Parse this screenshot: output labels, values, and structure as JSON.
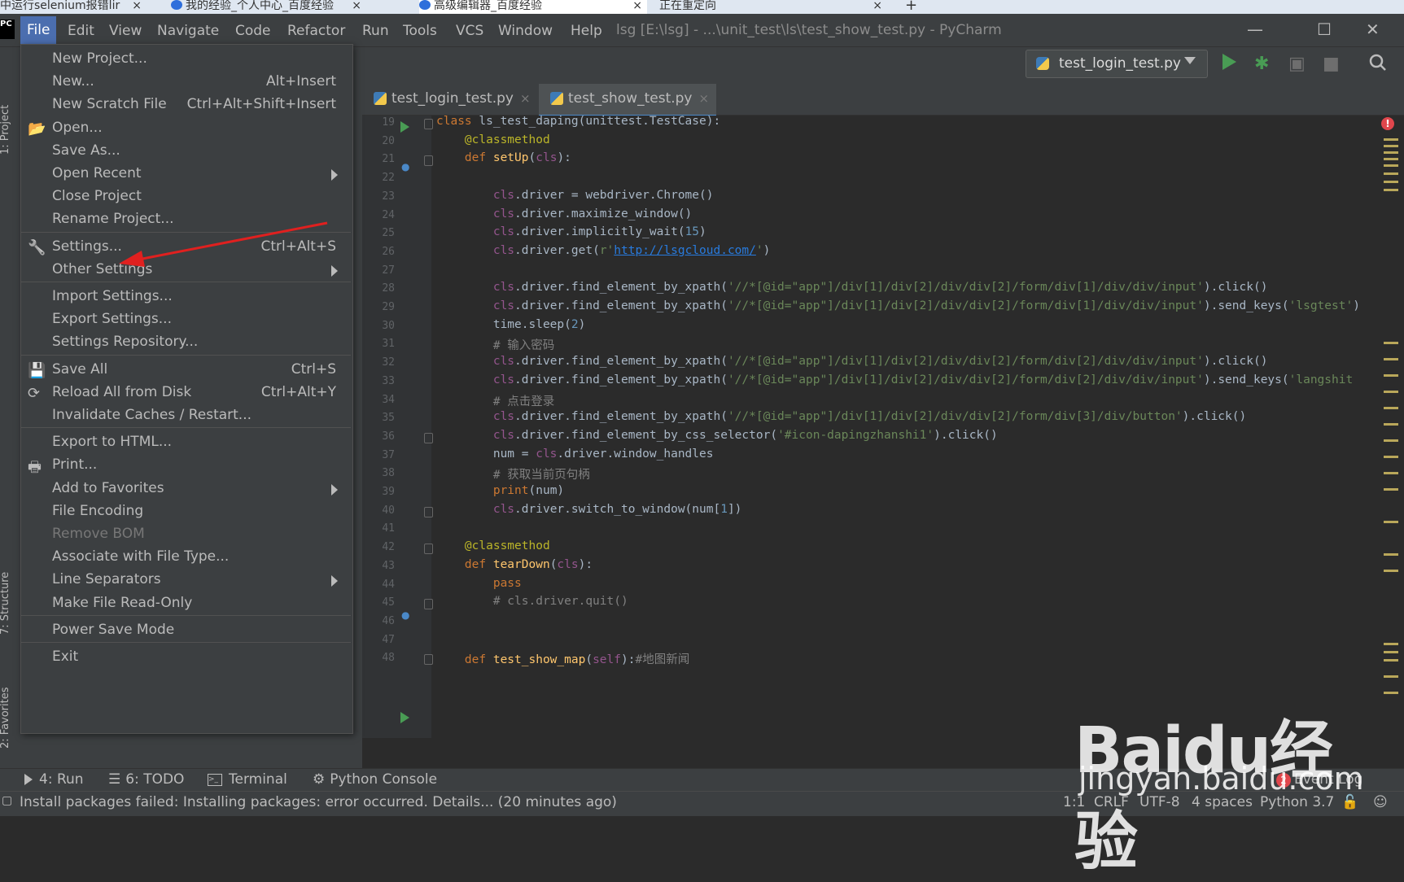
{
  "browser_tabs": [
    {
      "label": "中运行selenium报错lir",
      "close": "×"
    },
    {
      "label": "我的经验_个人中心_百度经验",
      "close": "×"
    },
    {
      "label": "高级编辑器_百度经验",
      "close": "×"
    },
    {
      "label": "正在重定向",
      "close": "×"
    },
    {
      "label": "+"
    }
  ],
  "app": {
    "logo": "PC"
  },
  "menubar": {
    "items": [
      "File",
      "Edit",
      "View",
      "Navigate",
      "Code",
      "Refactor",
      "Run",
      "Tools",
      "VCS",
      "Window",
      "Help"
    ],
    "window_title": "lsg [E:\\lsg] - ...\\unit_test\\ls\\test_show_test.py - PyCharm",
    "window_controls": [
      "—",
      "☐",
      "✕"
    ]
  },
  "toolbar": {
    "run_config": "test_login_test.py",
    "icons": [
      "run-icon",
      "debug-icon",
      "coverage-icon",
      "stop-icon",
      "search-icon"
    ]
  },
  "editor_tabs": [
    {
      "label": "test_login_test.py",
      "close": "×"
    },
    {
      "label": "test_show_test.py",
      "close": "×"
    }
  ],
  "side_labels": {
    "project": "1: Project",
    "structure": "7: Structure",
    "favorites": "2: Favorites"
  },
  "file_menu": {
    "groups": [
      [
        {
          "label": "New Project...",
          "shortcut": ""
        },
        {
          "label": "New...",
          "shortcut": "Alt+Insert"
        },
        {
          "label": "New Scratch File",
          "shortcut": "Ctrl+Alt+Shift+Insert"
        },
        {
          "label": "Open...",
          "shortcut": "",
          "icon": "folder-icon"
        },
        {
          "label": "Save As...",
          "shortcut": ""
        },
        {
          "label": "Open Recent",
          "shortcut": "",
          "submenu": true
        },
        {
          "label": "Close Project",
          "shortcut": ""
        },
        {
          "label": "Rename Project...",
          "shortcut": ""
        }
      ],
      [
        {
          "label": "Settings...",
          "shortcut": "Ctrl+Alt+S",
          "icon": "wrench-icon"
        },
        {
          "label": "Other Settings",
          "shortcut": "",
          "submenu": true
        }
      ],
      [
        {
          "label": "Import Settings...",
          "shortcut": ""
        },
        {
          "label": "Export Settings...",
          "shortcut": ""
        },
        {
          "label": "Settings Repository...",
          "shortcut": ""
        }
      ],
      [
        {
          "label": "Save All",
          "shortcut": "Ctrl+S",
          "icon": "save-icon"
        },
        {
          "label": "Reload All from Disk",
          "shortcut": "Ctrl+Alt+Y",
          "icon": "reload-icon"
        },
        {
          "label": "Invalidate Caches / Restart...",
          "shortcut": ""
        }
      ],
      [
        {
          "label": "Export to HTML...",
          "shortcut": ""
        },
        {
          "label": "Print...",
          "shortcut": "",
          "icon": "printer-icon"
        },
        {
          "label": "Add to Favorites",
          "shortcut": "",
          "submenu": true
        },
        {
          "label": "File Encoding",
          "shortcut": ""
        },
        {
          "label": "Remove BOM",
          "shortcut": "",
          "disabled": true
        },
        {
          "label": "Associate with File Type...",
          "shortcut": ""
        },
        {
          "label": "Line Separators",
          "shortcut": "",
          "submenu": true
        },
        {
          "label": "Make File Read-Only",
          "shortcut": ""
        }
      ],
      [
        {
          "label": "Power Save Mode",
          "shortcut": ""
        }
      ],
      [
        {
          "label": "Exit",
          "shortcut": ""
        }
      ]
    ]
  },
  "code_lines": [
    {
      "n": "19",
      "t": [
        [
          "kw",
          "class "
        ],
        [
          "",
          "ls_test_daping(unittest.TestCase):"
        ]
      ]
    },
    {
      "n": "20",
      "t": [
        [
          "",
          "    "
        ],
        [
          "dec",
          "@classmethod"
        ]
      ]
    },
    {
      "n": "21",
      "t": [
        [
          "",
          "    "
        ],
        [
          "kw",
          "def "
        ],
        [
          "fn",
          "setUp"
        ],
        [
          "",
          "("
        ],
        [
          "self",
          "cls"
        ],
        [
          "",
          "):"
        ]
      ]
    },
    {
      "n": "22",
      "t": [
        [
          "",
          ""
        ]
      ]
    },
    {
      "n": "23",
      "t": [
        [
          "",
          "        "
        ],
        [
          "self",
          "cls"
        ],
        [
          "",
          ".driver = webdriver.Chrome()"
        ]
      ]
    },
    {
      "n": "24",
      "t": [
        [
          "",
          "        "
        ],
        [
          "self",
          "cls"
        ],
        [
          "",
          ".driver.maximize_window()"
        ]
      ]
    },
    {
      "n": "25",
      "t": [
        [
          "",
          "        "
        ],
        [
          "self",
          "cls"
        ],
        [
          "",
          ".driver.implicitly_wait("
        ],
        [
          "num",
          "15"
        ],
        [
          "",
          ")"
        ]
      ]
    },
    {
      "n": "26",
      "t": [
        [
          "",
          "        "
        ],
        [
          "self",
          "cls"
        ],
        [
          "",
          ".driver.get("
        ],
        [
          "str",
          "r'"
        ],
        [
          "url",
          "http://lsgcloud.com/"
        ],
        [
          "str",
          "'"
        ],
        [
          "",
          ")"
        ]
      ]
    },
    {
      "n": "27",
      "t": [
        [
          "",
          ""
        ]
      ]
    },
    {
      "n": "28",
      "t": [
        [
          "",
          "        "
        ],
        [
          "self",
          "cls"
        ],
        [
          "",
          ".driver.find_element_by_xpath("
        ],
        [
          "str",
          "'//*[@id=\"app\"]/div[1]/div[2]/div/div[2]/form/div[1]/div/div/input'"
        ],
        [
          "",
          ").click()"
        ]
      ]
    },
    {
      "n": "29",
      "t": [
        [
          "",
          "        "
        ],
        [
          "self",
          "cls"
        ],
        [
          "",
          ".driver.find_element_by_xpath("
        ],
        [
          "str",
          "'//*[@id=\"app\"]/div[1]/div[2]/div/div[2]/form/div[1]/div/div/input'"
        ],
        [
          "",
          ").send_keys("
        ],
        [
          "str",
          "'lsgtest'"
        ],
        [
          "",
          ")"
        ]
      ]
    },
    {
      "n": "30",
      "t": [
        [
          "",
          "        time.sleep("
        ],
        [
          "num",
          "2"
        ],
        [
          "",
          ")"
        ]
      ]
    },
    {
      "n": "31",
      "t": [
        [
          "",
          "        "
        ],
        [
          "cmt",
          "# 输入密码"
        ]
      ]
    },
    {
      "n": "32",
      "t": [
        [
          "",
          "        "
        ],
        [
          "self",
          "cls"
        ],
        [
          "",
          ".driver.find_element_by_xpath("
        ],
        [
          "str",
          "'//*[@id=\"app\"]/div[1]/div[2]/div/div[2]/form/div[2]/div/div/input'"
        ],
        [
          "",
          ").click()"
        ]
      ]
    },
    {
      "n": "33",
      "t": [
        [
          "",
          "        "
        ],
        [
          "self",
          "cls"
        ],
        [
          "",
          ".driver.find_element_by_xpath("
        ],
        [
          "str",
          "'//*[@id=\"app\"]/div[1]/div[2]/div/div[2]/form/div[2]/div/div/input'"
        ],
        [
          "",
          ").send_keys("
        ],
        [
          "str",
          "'langshit"
        ]
      ]
    },
    {
      "n": "34",
      "t": [
        [
          "",
          "        "
        ],
        [
          "cmt",
          "# 点击登录"
        ]
      ]
    },
    {
      "n": "35",
      "t": [
        [
          "",
          "        "
        ],
        [
          "self",
          "cls"
        ],
        [
          "",
          ".driver.find_element_by_xpath("
        ],
        [
          "str",
          "'//*[@id=\"app\"]/div[1]/div[2]/div/div[2]/form/div[3]/div/button'"
        ],
        [
          "",
          ").click()"
        ]
      ]
    },
    {
      "n": "36",
      "t": [
        [
          "",
          "        "
        ],
        [
          "self",
          "cls"
        ],
        [
          "",
          ".driver.find_element_by_css_selector("
        ],
        [
          "str",
          "'#icon-dapingzhanshi1'"
        ],
        [
          "",
          ").click()"
        ]
      ]
    },
    {
      "n": "37",
      "t": [
        [
          "",
          "        num = "
        ],
        [
          "self",
          "cls"
        ],
        [
          "",
          ".driver.window_handles"
        ]
      ]
    },
    {
      "n": "38",
      "t": [
        [
          "",
          "        "
        ],
        [
          "cmt",
          "# 获取当前页句柄"
        ]
      ]
    },
    {
      "n": "39",
      "t": [
        [
          "",
          "        "
        ],
        [
          "kw",
          "print"
        ],
        [
          "",
          "(num)"
        ]
      ]
    },
    {
      "n": "40",
      "t": [
        [
          "",
          "        "
        ],
        [
          "self",
          "cls"
        ],
        [
          "",
          ".driver.switch_to_window(num["
        ],
        [
          "num",
          "1"
        ],
        [
          "",
          "])"
        ]
      ]
    },
    {
      "n": "41",
      "t": [
        [
          "",
          ""
        ]
      ]
    },
    {
      "n": "42",
      "t": [
        [
          "",
          "    "
        ],
        [
          "dec",
          "@classmethod"
        ]
      ]
    },
    {
      "n": "43",
      "t": [
        [
          "",
          "    "
        ],
        [
          "kw",
          "def "
        ],
        [
          "fn",
          "tearDown"
        ],
        [
          "",
          "("
        ],
        [
          "self",
          "cls"
        ],
        [
          "",
          "):"
        ]
      ]
    },
    {
      "n": "44",
      "t": [
        [
          "",
          "        "
        ],
        [
          "kw",
          "pass"
        ]
      ]
    },
    {
      "n": "45",
      "t": [
        [
          "",
          "        "
        ],
        [
          "cmt",
          "# cls.driver.quit()"
        ]
      ]
    },
    {
      "n": "46",
      "t": [
        [
          "",
          ""
        ]
      ]
    },
    {
      "n": "47",
      "t": [
        [
          "",
          ""
        ]
      ]
    },
    {
      "n": "48",
      "t": [
        [
          "",
          "    "
        ],
        [
          "kw",
          "def "
        ],
        [
          "fn",
          "test_show_map"
        ],
        [
          "",
          "("
        ],
        [
          "self",
          "self"
        ],
        [
          "",
          "):"
        ],
        [
          "cmt",
          "#地图新闻"
        ]
      ]
    }
  ],
  "bottom_tools": [
    "4: Run",
    "6: TODO",
    "Terminal",
    "Python Console"
  ],
  "event_log": {
    "badge": "2",
    "label": "Event Log"
  },
  "status": {
    "message": "Install packages failed: Installing packages: error occurred. Details... (20 minutes ago)",
    "position": "1:1",
    "line_sep": "CRLF",
    "encoding": "UTF-8",
    "indent": "4 spaces",
    "interpreter": "Python 3.7"
  },
  "watermark": {
    "brand": "Baidu经验",
    "domain": "jingyan.baidu.com"
  },
  "colors": {
    "accent": "#4b6eaf",
    "run_green": "#499c54",
    "error_red": "#e0464c"
  }
}
